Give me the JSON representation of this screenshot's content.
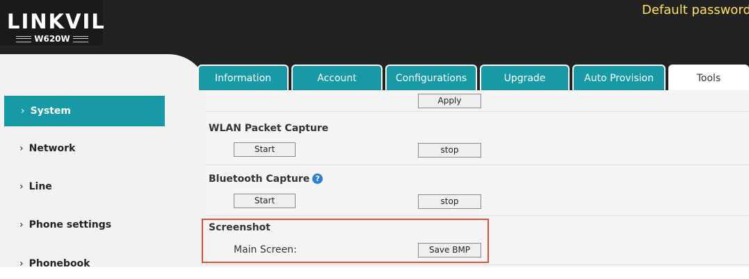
{
  "header": {
    "logo": {
      "brand": "LINKVIL",
      "model": "W620W"
    },
    "notice": "Default password"
  },
  "tabs": [
    {
      "label": "Information",
      "active": false
    },
    {
      "label": "Account",
      "active": false
    },
    {
      "label": "Configurations",
      "active": false
    },
    {
      "label": "Upgrade",
      "active": false
    },
    {
      "label": "Auto Provision",
      "active": false
    },
    {
      "label": "Tools",
      "active": true
    }
  ],
  "sidebar": {
    "chevron": "›",
    "items": [
      {
        "label": "System",
        "active": true
      },
      {
        "label": "Network",
        "active": false
      },
      {
        "label": "Line",
        "active": false
      },
      {
        "label": "Phone settings",
        "active": false
      },
      {
        "label": "Phonebook",
        "active": false
      }
    ]
  },
  "main": {
    "apply_label": "Apply",
    "wlan_capture": {
      "title": "WLAN Packet Capture",
      "start_label": "Start",
      "stop_label": "stop"
    },
    "bluetooth_capture": {
      "title": "Bluetooth Capture",
      "help_icon": "question-circle-icon",
      "start_label": "Start",
      "stop_label": "stop"
    },
    "screenshot": {
      "title": "Screenshot",
      "main_screen_label": "Main Screen:",
      "save_label": "Save BMP"
    }
  },
  "colors": {
    "header_bg": "#222222",
    "accent_teal": "#179aa6",
    "notice_yellow": "#ffe15a",
    "highlight_red": "#e0512f"
  }
}
